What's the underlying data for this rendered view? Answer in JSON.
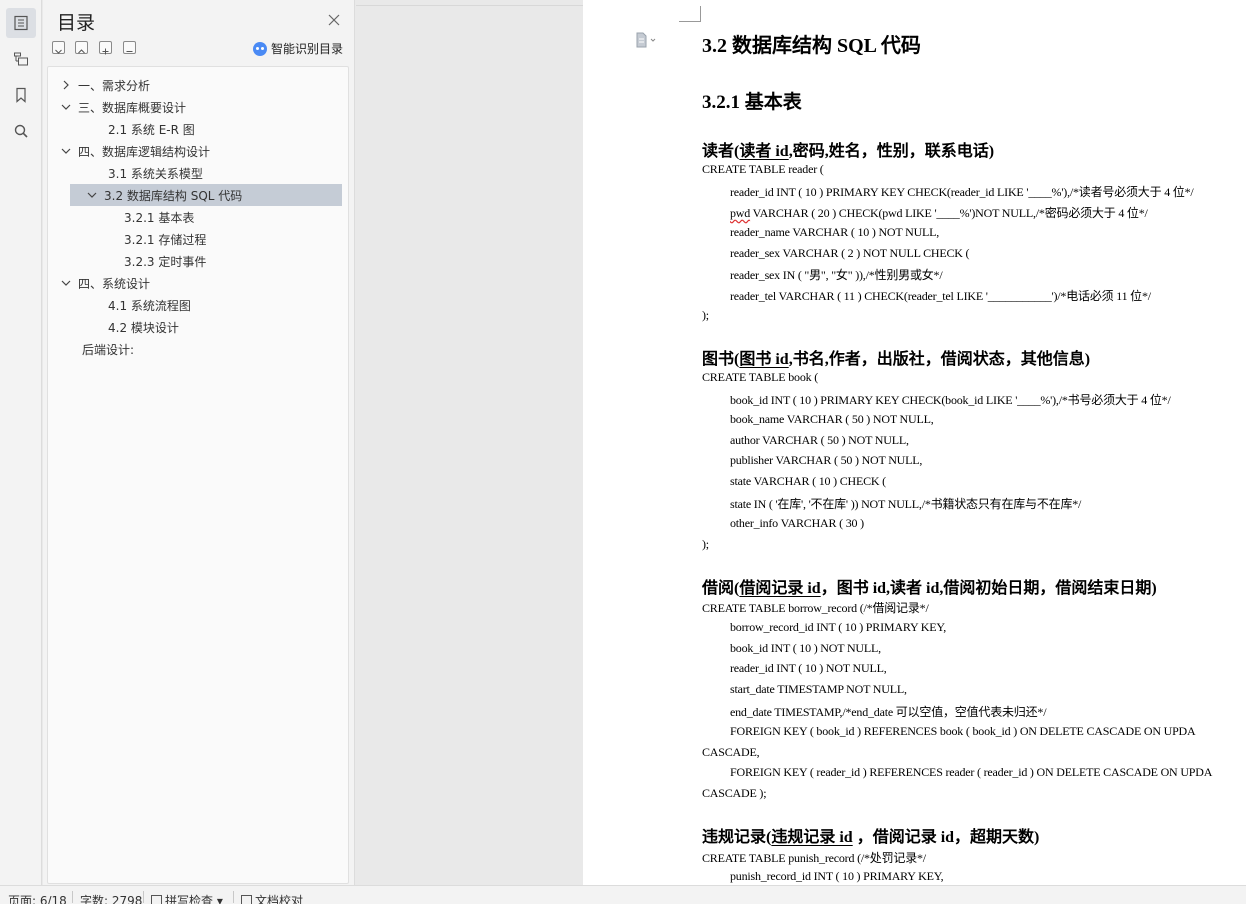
{
  "toc": {
    "title": "目录",
    "smart_label": "智能识别目录",
    "items": [
      {
        "label": "一、需求分析",
        "level": 0,
        "expand": "collapsed"
      },
      {
        "label": "三、数据库概要设计",
        "level": 0,
        "expand": "expanded"
      },
      {
        "label": "2.1  系统 E-R 图",
        "level": 1,
        "expand": "none"
      },
      {
        "label": "四、数据库逻辑结构设计",
        "level": 0,
        "expand": "expanded"
      },
      {
        "label": "3.1  系统关系模型",
        "level": 1,
        "expand": "none"
      },
      {
        "label": "3.2  数据库结构 SQL 代码",
        "level": 1,
        "expand": "expanded",
        "selected": true
      },
      {
        "label": "3.2.1 基本表",
        "level": 2,
        "expand": "none"
      },
      {
        "label": "3.2.1 存储过程",
        "level": 2,
        "expand": "none"
      },
      {
        "label": "3.2.3 定时事件",
        "level": 2,
        "expand": "none"
      },
      {
        "label": "四、系统设计",
        "level": 0,
        "expand": "expanded"
      },
      {
        "label": "4.1  系统流程图",
        "level": 1,
        "expand": "none"
      },
      {
        "label": "4.2  模块设计",
        "level": 1,
        "expand": "none"
      },
      {
        "label": "后端设计:",
        "level": 0,
        "expand": "none"
      }
    ]
  },
  "doc": {
    "h2": "3.2  数据库结构 SQL 代码",
    "h3": "3.2.1 基本表",
    "reader": {
      "head_pre": "读者(",
      "head_u": "读者 id",
      "head_post": ",密码,姓名，性别，联系电话)",
      "lines": [
        "CREATE TABLE reader (",
        "reader_id INT ( 10 ) PRIMARY KEY CHECK(reader_id LIKE '____%'),/*读者号必须大于 4 位*/",
        "VARCHAR ( 20 ) CHECK(pwd LIKE '____%')NOT NULL,/*密码必须大于 4 位*/",
        "reader_name VARCHAR ( 10 ) NOT NULL,",
        "reader_sex VARCHAR ( 2 ) NOT NULL CHECK (",
        "reader_sex IN ( \"男\", \"女\" )),/*性别男或女*/",
        "reader_tel VARCHAR ( 11 ) CHECK(reader_tel LIKE '___________')/*电话必须 11 位*/",
        ");"
      ],
      "pwd_word": "pwd"
    },
    "book": {
      "head_pre": "图书(",
      "head_u": "图书 id",
      "head_post": ",书名,作者，出版社，借阅状态，其他信息)",
      "lines": [
        "CREATE TABLE book (",
        "book_id INT ( 10 ) PRIMARY KEY CHECK(book_id LIKE '____%'),/*书号必须大于 4 位*/",
        "book_name VARCHAR ( 50 ) NOT NULL,",
        "author VARCHAR ( 50 ) NOT NULL,",
        "publisher VARCHAR ( 50 ) NOT NULL,",
        "state VARCHAR ( 10 ) CHECK (",
        "state IN ( '在库', '不在库' )) NOT NULL,/*书籍状态只有在库与不在库*/",
        "other_info VARCHAR ( 30 )",
        ");"
      ]
    },
    "borrow": {
      "head_pre": "借阅(",
      "head_u": "借阅记录 id",
      "head_post": "，图书 id,读者 id,借阅初始日期，借阅结束日期)",
      "lines": [
        "CREATE TABLE borrow_record (/*借阅记录*/",
        "borrow_record_id INT ( 10 ) PRIMARY KEY,",
        "book_id INT ( 10 ) NOT NULL,",
        "reader_id INT ( 10 ) NOT NULL,",
        "start_date TIMESTAMP NOT NULL,",
        "end_date TIMESTAMP,/*end_date 可以空值，空值代表未归还*/",
        "FOREIGN KEY ( book_id ) REFERENCES book ( book_id ) ON DELETE CASCADE ON UPDA",
        "CASCADE,",
        "FOREIGN KEY ( reader_id ) REFERENCES reader ( reader_id ) ON DELETE CASCADE ON UPDA",
        "CASCADE );"
      ]
    },
    "punish": {
      "head_pre": "违规记录(",
      "head_u": "违规记录 id",
      "head_post": " ，借阅记录 id，超期天数)",
      "lines": [
        "CREATE TABLE punish_record (/*处罚记录*/",
        "punish_record_id INT ( 10 ) PRIMARY KEY,"
      ]
    }
  },
  "status": {
    "page": "页面: 6/18",
    "words": "字数: 2798",
    "spell": "拼写检查",
    "proof": "文档校对"
  }
}
